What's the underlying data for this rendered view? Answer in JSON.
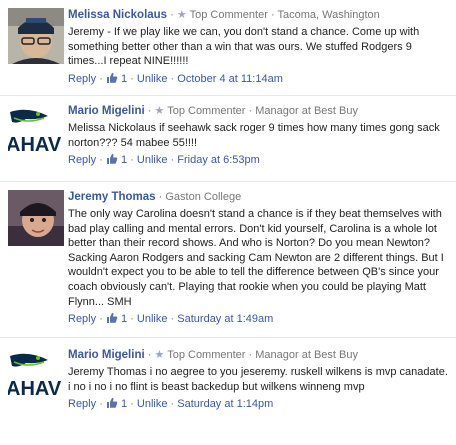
{
  "comments": [
    {
      "author": "Melissa Nickolaus",
      "badge": "Top Commenter",
      "affiliation": "Tacoma, Washington",
      "text": "Jeremy - If we play like we can, you don't stand a chance. Come up with something better other than a win that was ours. We stuffed Rodgers 9 times...I repeat NINE!!!!!!",
      "reply": "Reply",
      "likes": "1",
      "unlike": "Unlike",
      "time": "October 4 at 11:14am"
    },
    {
      "author": "Mario Migelini",
      "badge": "Top Commenter",
      "affiliation": "Managor at Best Buy",
      "text": "Melissa Nickolaus if seehawk sack roger 9 times how many times gong sack norton??? 54 mabee 55!!!!",
      "reply": "Reply",
      "likes": "1",
      "unlike": "Unlike",
      "time": "Friday at 6:53pm"
    },
    {
      "author": "Jeremy Thomas",
      "badge": "",
      "affiliation": "Gaston College",
      "text": "The only way Carolina doesn't stand a chance is if they beat themselves with bad play calling and mental errors. Don't kid yourself, Carolina is a whole lot better than their record shows. And who is Norton? Do you mean Newton? Sacking Aaron Rodgers and sacking Cam Newton are 2 different things. But I wouldn't expect you to be able to tell the difference between QB's since your coach obviously can't. Playing that rookie when you could be playing Matt Flynn... SMH",
      "reply": "Reply",
      "likes": "1",
      "unlike": "Unlike",
      "time": "Saturday at 1:49am"
    },
    {
      "author": "Mario Migelini",
      "badge": "Top Commenter",
      "affiliation": "Managor at Best Buy",
      "text": "Jeremy Thomas i no aegree to you jeseremy. ruskell wilkens is mvp canadate. i no i no i no flint is beast backedup but wilkens winneng mvp",
      "reply": "Reply",
      "likes": "1",
      "unlike": "Unlike",
      "time": "Saturday at 1:14pm"
    }
  ],
  "seahawks_logo_text": "AHAV",
  "colors": {
    "link": "#3b5998",
    "meta": "#777777",
    "seahawks_navy": "#0b2a4a",
    "seahawks_green": "#69be28"
  }
}
